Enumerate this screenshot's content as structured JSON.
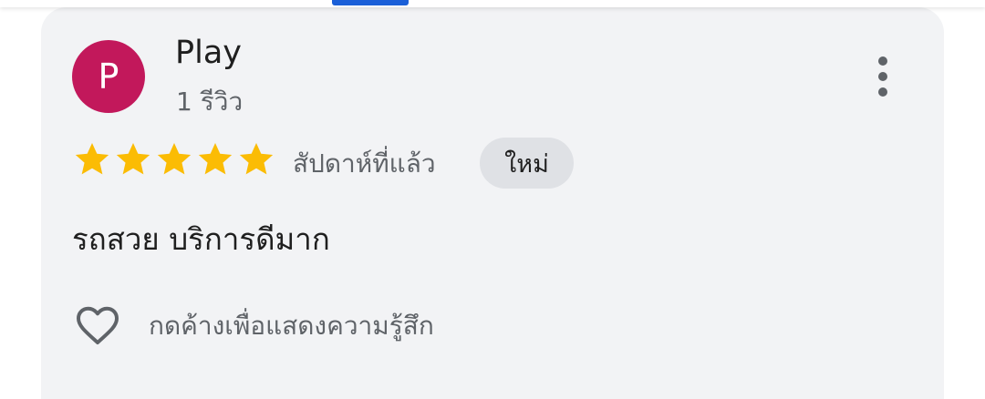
{
  "colors": {
    "avatar_bg": "#c2185b",
    "star": "#fbbc04",
    "tab_indicator": "#1a5fd8"
  },
  "review": {
    "author": {
      "initial": "P",
      "name": "Play",
      "review_count": "1 รีวิว"
    },
    "rating": 5,
    "rating_max": 5,
    "date": "สัปดาห์ที่แล้ว",
    "badge": "ใหม่",
    "text": "รถสวย บริการดีมาก",
    "reaction_label": "กดค้างเพื่อแสดงความรู้สึก",
    "icons": {
      "more": "more-vert-icon",
      "star": "star-icon",
      "reaction": "heart-outline-icon"
    }
  }
}
